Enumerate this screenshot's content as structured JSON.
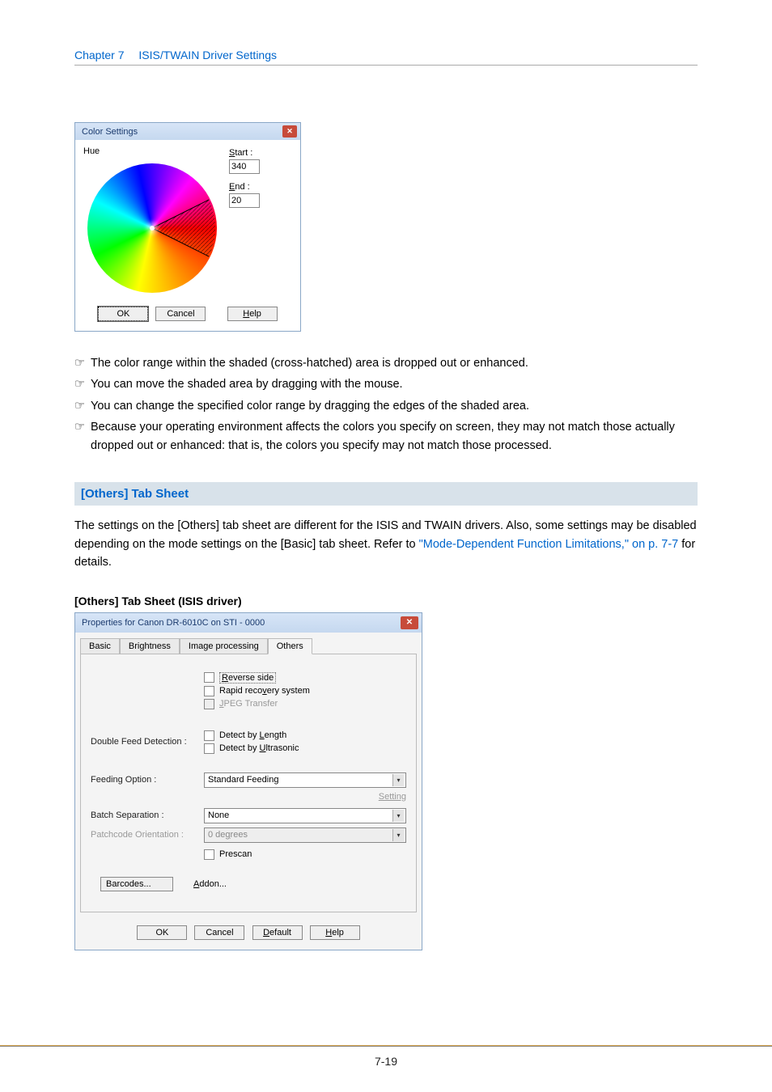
{
  "header": {
    "chapter": "Chapter 7",
    "title": "ISIS/TWAIN Driver Settings"
  },
  "colorDialog": {
    "title": "Color Settings",
    "hueLabel": "Hue",
    "startLabel": "Start :",
    "startUnderline": "S",
    "startValue": "340",
    "endLabel": "End :",
    "endUnderline": "E",
    "endValue": "20",
    "ok": "OK",
    "cancel": "Cancel",
    "help": "Help",
    "helpUnderline": "H"
  },
  "notes": {
    "bullet": "☞",
    "items": [
      "The color range within the shaded (cross-hatched) area is dropped out or enhanced.",
      "You can move the shaded area by dragging with the mouse.",
      "You can change the specified color range by dragging the edges of the shaded area.",
      "Because your operating environment affects the colors you specify on screen, they may not match those actually dropped out or enhanced: that is, the colors you specify may not match those processed."
    ]
  },
  "section": {
    "title": "[Others] Tab Sheet",
    "body_a": "The settings on the [Others] tab sheet are different for the ISIS and TWAIN drivers. Also, some settings may be disabled depending on the mode settings on the [Basic] tab sheet. Refer to ",
    "body_link": "\"Mode-Dependent Function Limitations,\" on p. 7-7",
    "body_b": " for details."
  },
  "subhead": "[Others] Tab Sheet (ISIS driver)",
  "propDialog": {
    "title": "Properties for Canon DR-6010C on STI - 0000",
    "tabs": {
      "basic": "Basic",
      "brightness": "Brightness",
      "image": "Image processing",
      "others": "Others"
    },
    "reverseSide": "Reverse side",
    "reverseUL": "R",
    "rapidRecovery": "Rapid recovery system",
    "rapidUL": "v",
    "jpeg": "JPEG Transfer",
    "jpegUL": "J",
    "doubleFeed": {
      "label": "Double Feed Detection :",
      "byLength": "Detect by Length",
      "lenUL": "L",
      "byUltra": "Detect by Ultrasonic",
      "ultraUL": "U"
    },
    "feeding": {
      "label": "Feeding Option :",
      "value": "Standard Feeding",
      "setting": "Setting",
      "settingUL": "S"
    },
    "batch": {
      "label": "Batch Separation :",
      "value": "None"
    },
    "patch": {
      "label": "Patchcode Orientation :",
      "value": "0 degrees",
      "degUL": "g"
    },
    "prescan": "Prescan",
    "barcodes": "Barcodes...",
    "barcodesUL": "B",
    "addon": "Addon...",
    "addonUL": "A",
    "ok": "OK",
    "cancel": "Cancel",
    "default": "Default",
    "defaultUL": "D",
    "help": "Help",
    "helpUL": "H"
  },
  "pageNumber": "7-19"
}
